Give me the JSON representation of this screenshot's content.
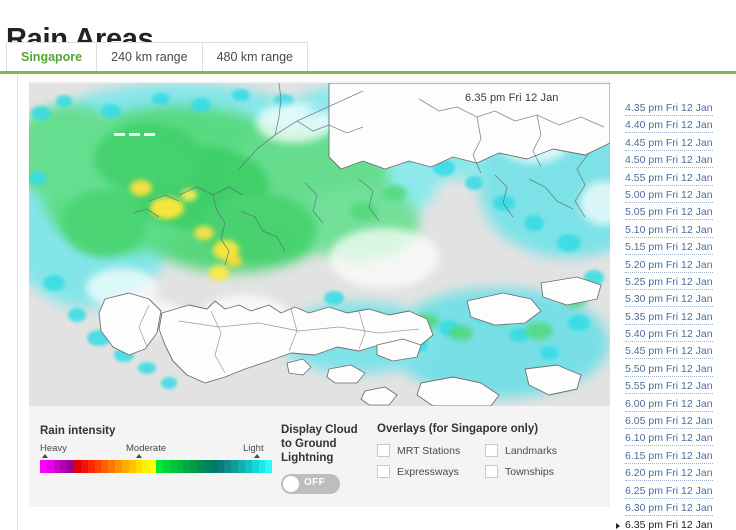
{
  "page": {
    "title": "Rain Areas"
  },
  "tabs": [
    {
      "label": "Singapore",
      "active": true
    },
    {
      "label": "240 km range",
      "active": false
    },
    {
      "label": "480 km range",
      "active": false
    }
  ],
  "map": {
    "timestamp_overlay": "6.35 pm Fri 12 Jan",
    "background_color": "#e2e2e2",
    "land_color": "#fdfdfd",
    "outline_color": "#6b6b6b"
  },
  "legend": {
    "rain_intensity_title": "Rain intensity",
    "scale_labels": {
      "heavy": "Heavy",
      "moderate": "Moderate",
      "light": "Light"
    },
    "colors": [
      "#ff00ff",
      "#e800e8",
      "#cc00cc",
      "#b300b3",
      "#990099",
      "#e00000",
      "#f01010",
      "#ff2a00",
      "#ff4400",
      "#ff5e00",
      "#ff7800",
      "#ff9200",
      "#ffac00",
      "#ffc400",
      "#ffdc00",
      "#fff200",
      "#ffff00",
      "#00e83c",
      "#00d63c",
      "#00c63c",
      "#00b83c",
      "#00aa42",
      "#009c48",
      "#008e50",
      "#00825a",
      "#007a68",
      "#0f7878",
      "#108a8a",
      "#0f9c9c",
      "#0eb0b0",
      "#10c4c4",
      "#14d8d8",
      "#1ceaea",
      "#2ff7f7"
    ]
  },
  "lightning": {
    "label": "Display Cloud to Ground Lightning",
    "toggle_state": "OFF"
  },
  "overlays": {
    "title": "Overlays (for Singapore only)",
    "items": [
      {
        "label": "MRT Stations",
        "checked": false
      },
      {
        "label": "Landmarks",
        "checked": false
      },
      {
        "label": "Expressways",
        "checked": false
      },
      {
        "label": "Townships",
        "checked": false
      }
    ]
  },
  "timestamps": [
    {
      "label": "4.35 pm Fri 12 Jan",
      "current": false
    },
    {
      "label": "4.40 pm Fri 12 Jan",
      "current": false
    },
    {
      "label": "4.45 pm Fri 12 Jan",
      "current": false
    },
    {
      "label": "4.50 pm Fri 12 Jan",
      "current": false
    },
    {
      "label": "4.55 pm Fri 12 Jan",
      "current": false
    },
    {
      "label": "5.00 pm Fri 12 Jan",
      "current": false
    },
    {
      "label": "5.05 pm Fri 12 Jan",
      "current": false
    },
    {
      "label": "5.10 pm Fri 12 Jan",
      "current": false
    },
    {
      "label": "5.15 pm Fri 12 Jan",
      "current": false
    },
    {
      "label": "5.20 pm Fri 12 Jan",
      "current": false
    },
    {
      "label": "5.25 pm Fri 12 Jan",
      "current": false
    },
    {
      "label": "5.30 pm Fri 12 Jan",
      "current": false
    },
    {
      "label": "5.35 pm Fri 12 Jan",
      "current": false
    },
    {
      "label": "5.40 pm Fri 12 Jan",
      "current": false
    },
    {
      "label": "5.45 pm Fri 12 Jan",
      "current": false
    },
    {
      "label": "5.50 pm Fri 12 Jan",
      "current": false
    },
    {
      "label": "5.55 pm Fri 12 Jan",
      "current": false
    },
    {
      "label": "6.00 pm Fri 12 Jan",
      "current": false
    },
    {
      "label": "6.05 pm Fri 12 Jan",
      "current": false
    },
    {
      "label": "6.10 pm Fri 12 Jan",
      "current": false
    },
    {
      "label": "6.15 pm Fri 12 Jan",
      "current": false
    },
    {
      "label": "6.20 pm Fri 12 Jan",
      "current": false
    },
    {
      "label": "6.25 pm Fri 12 Jan",
      "current": false
    },
    {
      "label": "6.30 pm Fri 12 Jan",
      "current": false
    },
    {
      "label": "6.35 pm Fri 12 Jan",
      "current": true
    }
  ],
  "theme": {
    "accent_green": "#55a630",
    "tab_underline": "#77bb55",
    "link_blue": "#4a6e9b",
    "panel_gray": "#f4f4f4"
  }
}
